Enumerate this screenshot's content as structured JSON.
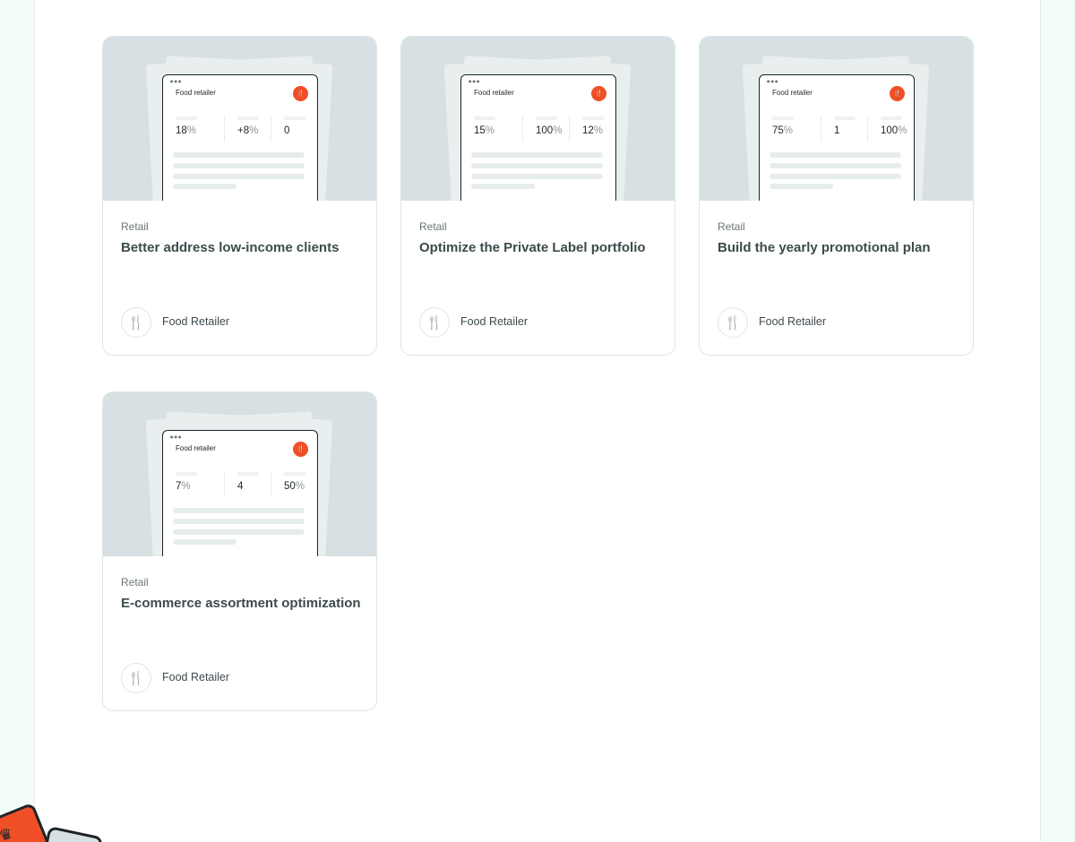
{
  "colors": {
    "accent": "#ef4e26",
    "card_border": "#e1e6e7",
    "thumb_bg": "#d7e0e2",
    "page_bg": "#f4fbfb"
  },
  "cards": [
    {
      "mock_title": "Food retailer",
      "mock_icon": "fork-knife-icon",
      "stats": [
        {
          "value": "18",
          "unit": "%"
        },
        {
          "value": "+8",
          "unit": "%"
        },
        {
          "value": "0",
          "unit": ""
        }
      ],
      "category": "Retail",
      "title": "Better address low-income clients",
      "tag_icon": "fork-knife-icon",
      "tag_label": "Food Retailer"
    },
    {
      "mock_title": "Food retailer",
      "mock_icon": "fork-knife-icon",
      "stats": [
        {
          "value": "15",
          "unit": "%"
        },
        {
          "value": "100",
          "unit": "%"
        },
        {
          "value": "12",
          "unit": "%"
        }
      ],
      "category": "Retail",
      "title": "Optimize the Private Label portfolio",
      "tag_icon": "fork-knife-icon",
      "tag_label": "Food Retailer"
    },
    {
      "mock_title": "Food retailer",
      "mock_icon": "fork-knife-icon",
      "stats": [
        {
          "value": "75",
          "unit": "%"
        },
        {
          "value": "1",
          "unit": ""
        },
        {
          "value": "100",
          "unit": "%"
        }
      ],
      "category": "Retail",
      "title": "Build the yearly promotional plan",
      "tag_icon": "fork-knife-icon",
      "tag_label": "Food Retailer"
    },
    {
      "mock_title": "Food retailer",
      "mock_icon": "fork-knife-icon",
      "stats": [
        {
          "value": "7",
          "unit": "%"
        },
        {
          "value": "4",
          "unit": ""
        },
        {
          "value": "50",
          "unit": "%"
        }
      ],
      "category": "Retail",
      "title": "E-commerce assortment optimization",
      "tag_icon": "fork-knife-icon",
      "tag_label": "Food Retailer"
    }
  ]
}
